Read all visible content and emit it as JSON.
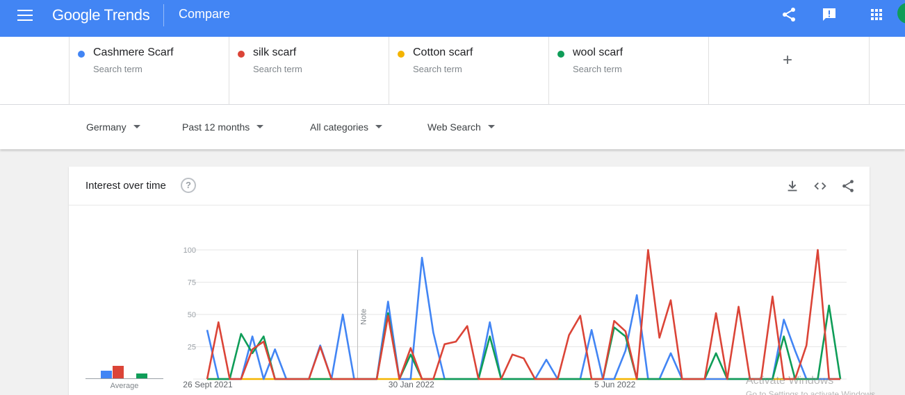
{
  "header": {
    "logo": "Google Trends",
    "title": "Compare"
  },
  "terms": [
    {
      "name": "Cashmere Scarf",
      "sub": "Search term",
      "color": "#4285f4"
    },
    {
      "name": "silk scarf",
      "sub": "Search term",
      "color": "#db4437"
    },
    {
      "name": "Cotton scarf",
      "sub": "Search term",
      "color": "#f4b400"
    },
    {
      "name": "wool scarf",
      "sub": "Search term",
      "color": "#0f9d58"
    }
  ],
  "add_term": "+",
  "filters": {
    "region": "Germany",
    "period": "Past 12 months",
    "category": "All categories",
    "search_type": "Web Search"
  },
  "card": {
    "title": "Interest over time",
    "help": "?",
    "average_label": "Average"
  },
  "watermark": {
    "line1": "Activate Windows",
    "line2": "Go to Settings to activate Windows."
  },
  "chart_data": {
    "type": "line",
    "yticks": [
      25,
      50,
      75,
      100
    ],
    "ylim": [
      0,
      100
    ],
    "x_tick_labels": [
      "26 Sept 2021",
      "30 Jan 2022",
      "5 Jun 2022"
    ],
    "x_tick_index": [
      0,
      18,
      36
    ],
    "note_index": 13,
    "note_label": "Note",
    "average": [
      {
        "name": "Cashmere Scarf",
        "value": 12,
        "color": "#4285f4"
      },
      {
        "name": "silk scarf",
        "value": 19,
        "color": "#db4437"
      },
      {
        "name": "Cotton scarf",
        "value": 0,
        "color": "#f4b400"
      },
      {
        "name": "wool scarf",
        "value": 8,
        "color": "#0f9d58"
      }
    ],
    "series": [
      {
        "name": "Cashmere Scarf",
        "color": "#4285f4",
        "values": [
          38,
          0,
          0,
          0,
          33,
          0,
          23,
          0,
          0,
          0,
          26,
          0,
          50,
          0,
          0,
          0,
          60,
          0,
          0,
          94,
          36,
          0,
          0,
          0,
          0,
          44,
          0,
          0,
          0,
          0,
          15,
          0,
          0,
          0,
          38,
          0,
          0,
          22,
          65,
          0,
          0,
          20,
          0,
          0,
          0,
          0,
          0,
          0,
          0,
          0,
          0,
          46,
          22,
          0,
          0,
          0,
          0
        ]
      },
      {
        "name": "silk scarf",
        "color": "#db4437",
        "values": [
          0,
          44,
          0,
          0,
          23,
          29,
          0,
          0,
          0,
          0,
          25,
          0,
          0,
          0,
          0,
          0,
          49,
          0,
          24,
          0,
          0,
          27,
          29,
          41,
          0,
          0,
          0,
          19,
          16,
          0,
          0,
          0,
          34,
          49,
          0,
          0,
          45,
          37,
          0,
          100,
          32,
          61,
          0,
          0,
          0,
          51,
          0,
          56,
          0,
          0,
          64,
          0,
          0,
          26,
          100,
          0,
          0
        ]
      },
      {
        "name": "Cotton scarf",
        "color": "#f4b400",
        "values": [
          0,
          0,
          0,
          0,
          0,
          0,
          0,
          0,
          0,
          0,
          0,
          0,
          0,
          0,
          0,
          0,
          0,
          0,
          0,
          0,
          0,
          0,
          0,
          0,
          0,
          0,
          0,
          0,
          0,
          0,
          0,
          0,
          0,
          0,
          0,
          0,
          0,
          0,
          0,
          0,
          0,
          0,
          0,
          0,
          0,
          0,
          0,
          0,
          0,
          0,
          0,
          0,
          0,
          0,
          0,
          0,
          0
        ]
      },
      {
        "name": "wool scarf",
        "color": "#0f9d58",
        "values": [
          0,
          0,
          0,
          35,
          20,
          33,
          0,
          0,
          0,
          0,
          0,
          0,
          0,
          0,
          0,
          0,
          51,
          0,
          19,
          0,
          0,
          0,
          0,
          0,
          0,
          33,
          0,
          0,
          0,
          0,
          0,
          0,
          0,
          0,
          0,
          0,
          40,
          33,
          0,
          0,
          0,
          0,
          0,
          0,
          0,
          20,
          0,
          0,
          0,
          0,
          0,
          33,
          0,
          0,
          0,
          57,
          0
        ]
      }
    ]
  }
}
